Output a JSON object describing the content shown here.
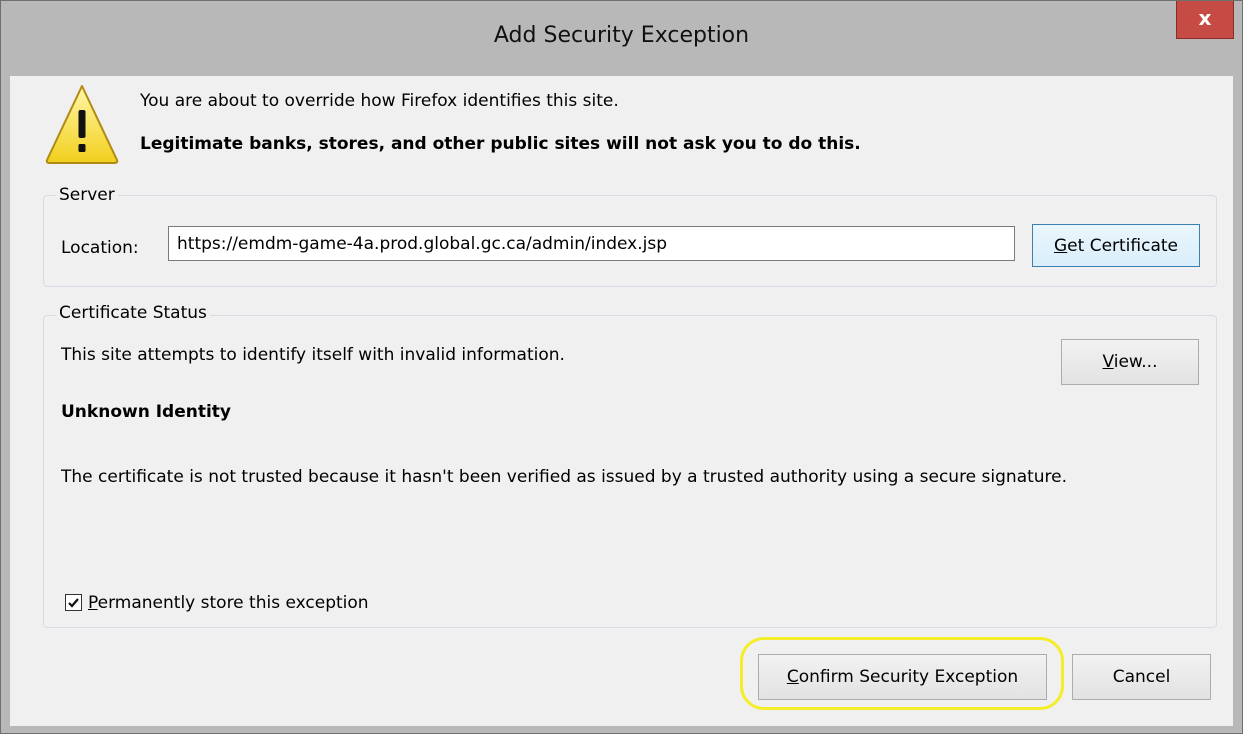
{
  "window": {
    "title": "Add Security Exception",
    "close_glyph": "x"
  },
  "warning": {
    "icon": "warning-icon",
    "line1": "You are about to override how Firefox identifies this site.",
    "line2": "Legitimate banks, stores, and other public sites will not ask you to do this."
  },
  "server": {
    "group_label": "Server",
    "location_label": "Location:",
    "location_value": "https://emdm-game-4a.prod.global.gc.ca/admin/index.jsp",
    "get_certificate_prefix": "G",
    "get_certificate_rest": "et Certificate"
  },
  "certificate_status": {
    "group_label": "Certificate Status",
    "status_text": "This site attempts to identify itself with invalid information.",
    "view_prefix": "V",
    "view_rest": "iew...",
    "identity_heading": "Unknown Identity",
    "detail": "The certificate is not trusted because it hasn't been verified as issued by a trusted authority using a secure signature.",
    "permanent_checked": true,
    "permanent_prefix": "P",
    "permanent_rest": "ermanently store this exception"
  },
  "buttons": {
    "confirm_prefix": "C",
    "confirm_rest": "onfirm Security Exception",
    "cancel": "Cancel"
  },
  "colors": {
    "highlight": "#f4ee2a",
    "close_button": "#c74b45",
    "titlebar": "#b8b8b8"
  }
}
